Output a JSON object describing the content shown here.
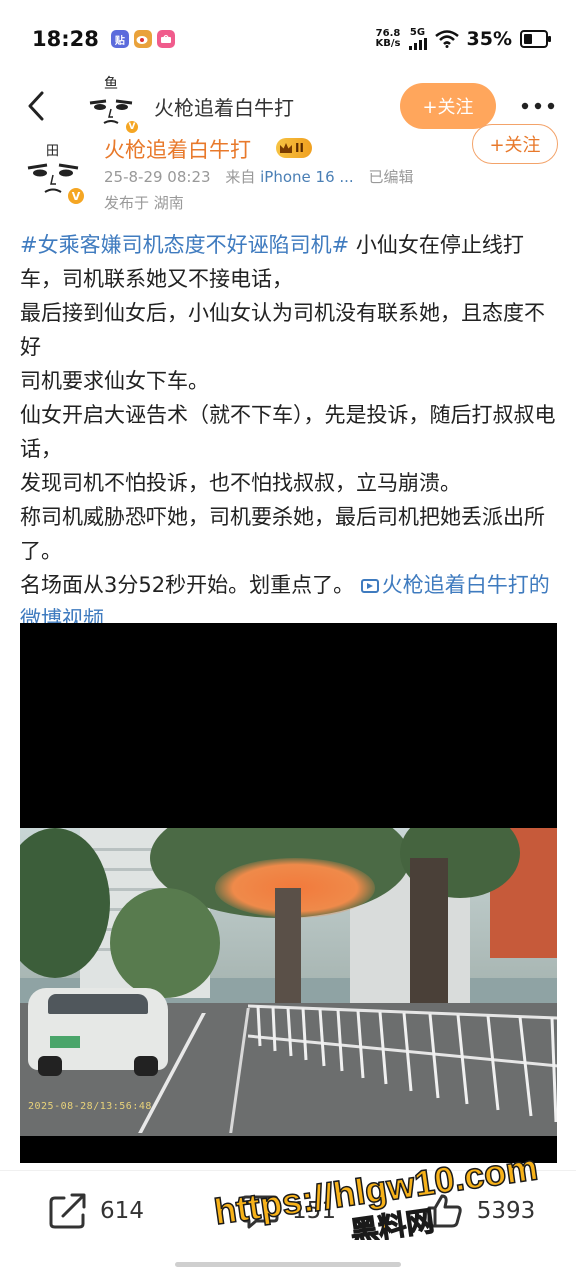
{
  "status_bar": {
    "time": "18:28",
    "app_icons": [
      {
        "name": "tieba-icon",
        "label": "贴",
        "color": "#5b6bdc"
      },
      {
        "name": "weibo-icon",
        "label": "",
        "color": "#e9a23b"
      },
      {
        "name": "shop-icon",
        "label": "",
        "color": "#f05c8c"
      }
    ],
    "net_speed_value": "76.8",
    "net_speed_unit": "KB/s",
    "network": "5G",
    "battery": "35%"
  },
  "nav": {
    "title": "火枪追着白牛打",
    "follow_label": "+关注",
    "avatar_char": "鱼",
    "follow_color": "#ffa65c"
  },
  "post": {
    "author": "火枪追着白牛打",
    "level": "II",
    "date": "25-8-29 08:23",
    "from_label": "来自",
    "device": "iPhone 16 ...",
    "edited": "已编辑",
    "location": "发布于 湖南",
    "follow_label": "+关注",
    "avatar_char": "田",
    "hashtag": "#女乘客嫌司机态度不好诬陷司机#",
    "lines": [
      " 小仙女在停止线打车，司机联系她又不接电话，",
      "最后接到仙女后，小仙女认为司机没有联系她，且态度不好",
      "司机要求仙女下车。",
      "仙女开启大诬告术（就不下车），先是投诉，随后打叔叔电话，",
      "发现司机不怕投诉，也不怕找叔叔，立马崩溃。",
      "称司机威胁恐吓她，司机要杀她，最后司机把她丢派出所了。",
      "名场面从3分52秒开始。划重点了。"
    ],
    "video_link": "火枪追着白牛打的微博视频",
    "link_color": "#3f7bbf"
  },
  "video": {
    "timestamp": "2025-08-28/13:56:48"
  },
  "actions": {
    "share_count": "614",
    "comment_count": "151",
    "like_count": "5393"
  },
  "watermark": {
    "line1": "https://hlgw10.com",
    "line2": "黑料网"
  }
}
